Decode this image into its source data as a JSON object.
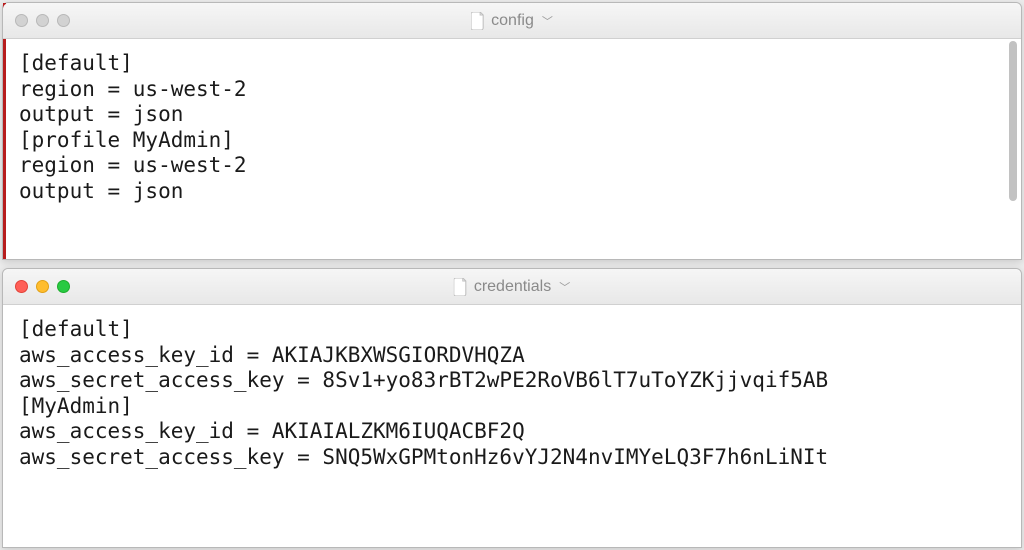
{
  "window1": {
    "title": "config",
    "traffic_lights_active": false,
    "accent_color": "#b71c1c",
    "lines": [
      "[default]",
      "region = us-west-2",
      "output = json",
      "[profile MyAdmin]",
      "region = us-west-2",
      "output = json"
    ]
  },
  "window2": {
    "title": "credentials",
    "traffic_lights_active": true,
    "lines": [
      "[default]",
      "aws_access_key_id = AKIAJKBXWSGIORDVHQZA",
      "aws_secret_access_key = 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",
      "[MyAdmin]",
      "aws_access_key_id = AKIAIALZKM6IUQACBF2Q",
      "aws_secret_access_key = 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"
    ]
  }
}
